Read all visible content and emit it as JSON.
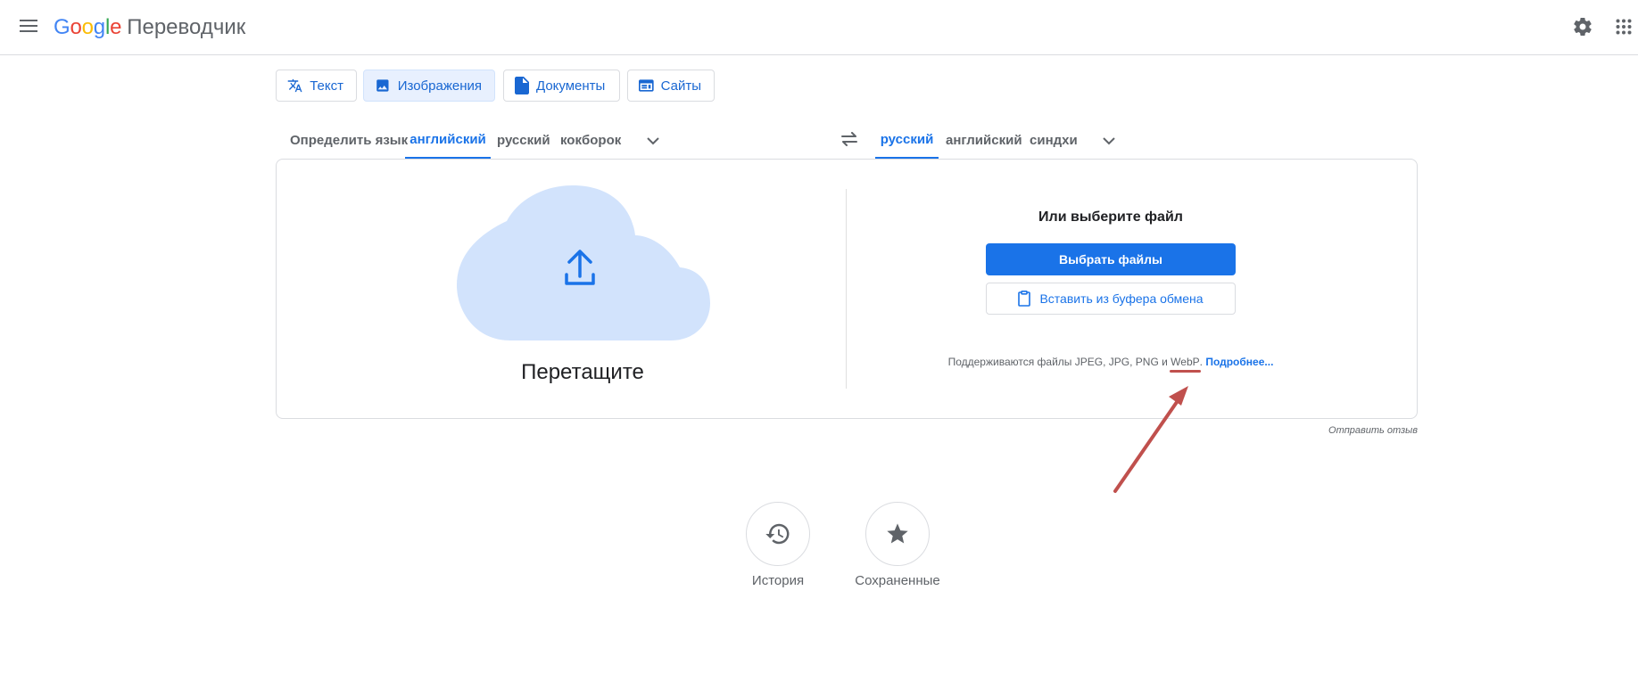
{
  "header": {
    "logo_text": "Google",
    "product_name": "Переводчик"
  },
  "mode_tabs": [
    {
      "label": "Текст",
      "active": false
    },
    {
      "label": "Изображения",
      "active": true
    },
    {
      "label": "Документы",
      "active": false
    },
    {
      "label": "Сайты",
      "active": false
    }
  ],
  "source_languages": [
    {
      "label": "Определить язык",
      "active": false
    },
    {
      "label": "английский",
      "active": true
    },
    {
      "label": "русский",
      "active": false
    },
    {
      "label": "кокборок",
      "active": false
    }
  ],
  "target_languages": [
    {
      "label": "русский",
      "active": true
    },
    {
      "label": "английский",
      "active": false
    },
    {
      "label": "синдхи",
      "active": false
    }
  ],
  "upload": {
    "drag_label": "Перетащите",
    "choose_title": "Или выберите файл",
    "choose_files_label": "Выбрать файлы",
    "paste_label": "Вставить из буфера обмена",
    "supported_prefix": "Поддерживаются файлы JPEG, JPG, PNG и ",
    "supported_webp": "WebP",
    "supported_suffix": ".",
    "more_link": "Подробнее..."
  },
  "feedback_link": "Отправить отзыв",
  "bottom": {
    "history_label": "История",
    "saved_label": "Сохраненные"
  },
  "colors": {
    "accent": "#1a73e8",
    "annotation": "#c0504d",
    "cloud": "#d2e3fc"
  }
}
